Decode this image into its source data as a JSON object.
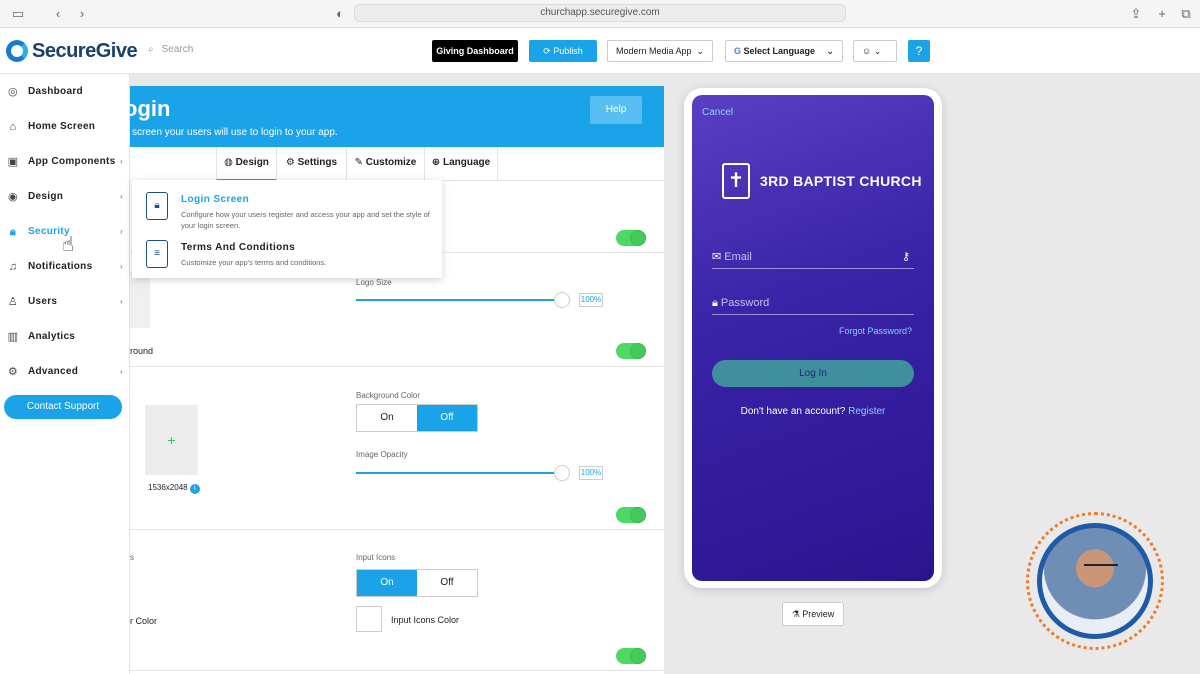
{
  "browser": {
    "url": "churchapp.securegive.com"
  },
  "header": {
    "brand": "SecureGive",
    "search_placeholder": "Search",
    "giving_dashboard": "Giving Dashboard",
    "publish": "Publish",
    "app_select": "Modern Media App",
    "language_select": "Select Language"
  },
  "sidebar": {
    "items": [
      {
        "label": "Dashboard",
        "icon": "gauge-icon"
      },
      {
        "label": "Home Screen",
        "icon": "home-icon"
      },
      {
        "label": "App Components",
        "icon": "components-icon"
      },
      {
        "label": "Design",
        "icon": "palette-icon"
      },
      {
        "label": "Security",
        "icon": "lock-icon"
      },
      {
        "label": "Notifications",
        "icon": "bell-icon"
      },
      {
        "label": "Users",
        "icon": "user-icon"
      },
      {
        "label": "Analytics",
        "icon": "chart-icon"
      },
      {
        "label": "Advanced",
        "icon": "gear-icon"
      }
    ],
    "contact_support": "Contact Support"
  },
  "panel": {
    "title": "ogin",
    "subtitle": "screen your users will use to login to your app.",
    "help": "Help",
    "tabs": [
      "Design",
      "Settings",
      "Customize",
      "Language"
    ],
    "logo_size_label": "Logo Size",
    "logo_size_value": "100%",
    "background_label": "round",
    "background_color_label": "Background Color",
    "on": "On",
    "off": "Off",
    "image_dims": "1536x2048",
    "image_opacity_label": "Image Opacity",
    "image_opacity_value": "100%",
    "section_cut_label": "s",
    "input_icons_label": "Input Icons",
    "color_cut_label": "r Color",
    "input_icons_color": "Input Icons Color"
  },
  "security_menu": [
    {
      "title": "Login Screen",
      "desc": "Configure how your users register and access your app and set the style of your login screen."
    },
    {
      "title": "Terms And Conditions",
      "desc": "Customize your app's terms and conditions."
    }
  ],
  "phone": {
    "cancel": "Cancel",
    "church_name": "3RD BAPTIST CHURCH",
    "email_placeholder": "Email",
    "password_placeholder": "Password",
    "forgot": "Forgot Password?",
    "login": "Log In",
    "no_account": "Don't have an account?",
    "register": "Register"
  },
  "preview_button": "Preview",
  "colors": {
    "accent": "#1aa3e8",
    "toggle_on": "#4cd964",
    "phone_bg": "#3a24a8"
  }
}
